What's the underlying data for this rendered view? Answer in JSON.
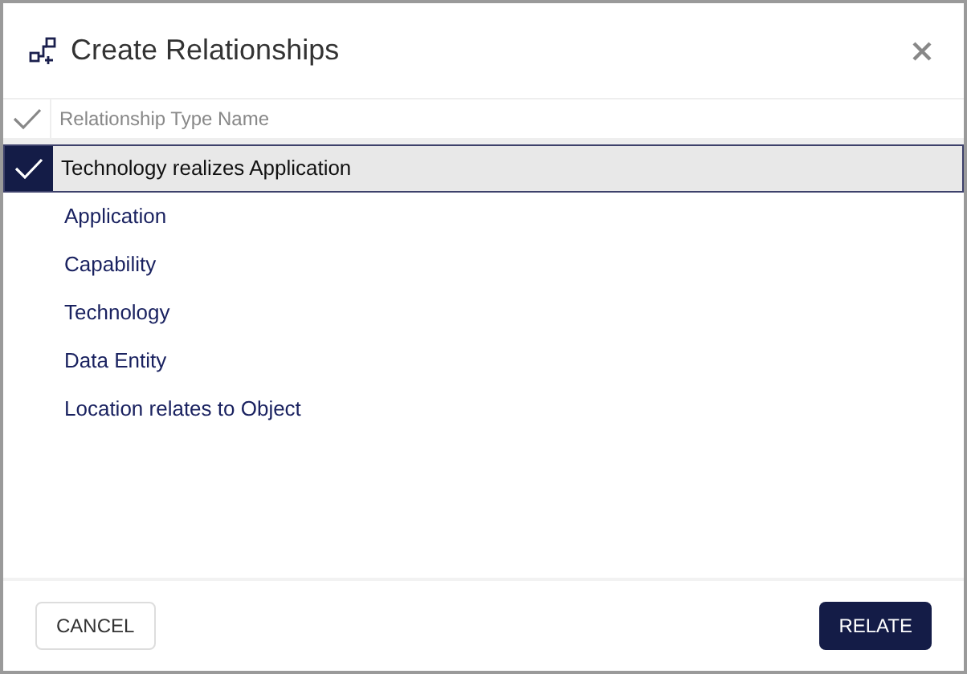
{
  "dialog": {
    "title": "Create Relationships"
  },
  "table": {
    "columns": [
      "Relationship Type Name"
    ],
    "rows": [
      {
        "name": "Technology realizes Application",
        "selected": true
      },
      {
        "name": "Application",
        "selected": false
      },
      {
        "name": "Capability",
        "selected": false
      },
      {
        "name": "Technology",
        "selected": false
      },
      {
        "name": "Data Entity",
        "selected": false
      },
      {
        "name": "Location relates to Object",
        "selected": false
      }
    ]
  },
  "buttons": [
    {
      "label": "CANCEL",
      "kind": "secondary"
    },
    {
      "label": "RELATE",
      "kind": "primary"
    }
  ]
}
